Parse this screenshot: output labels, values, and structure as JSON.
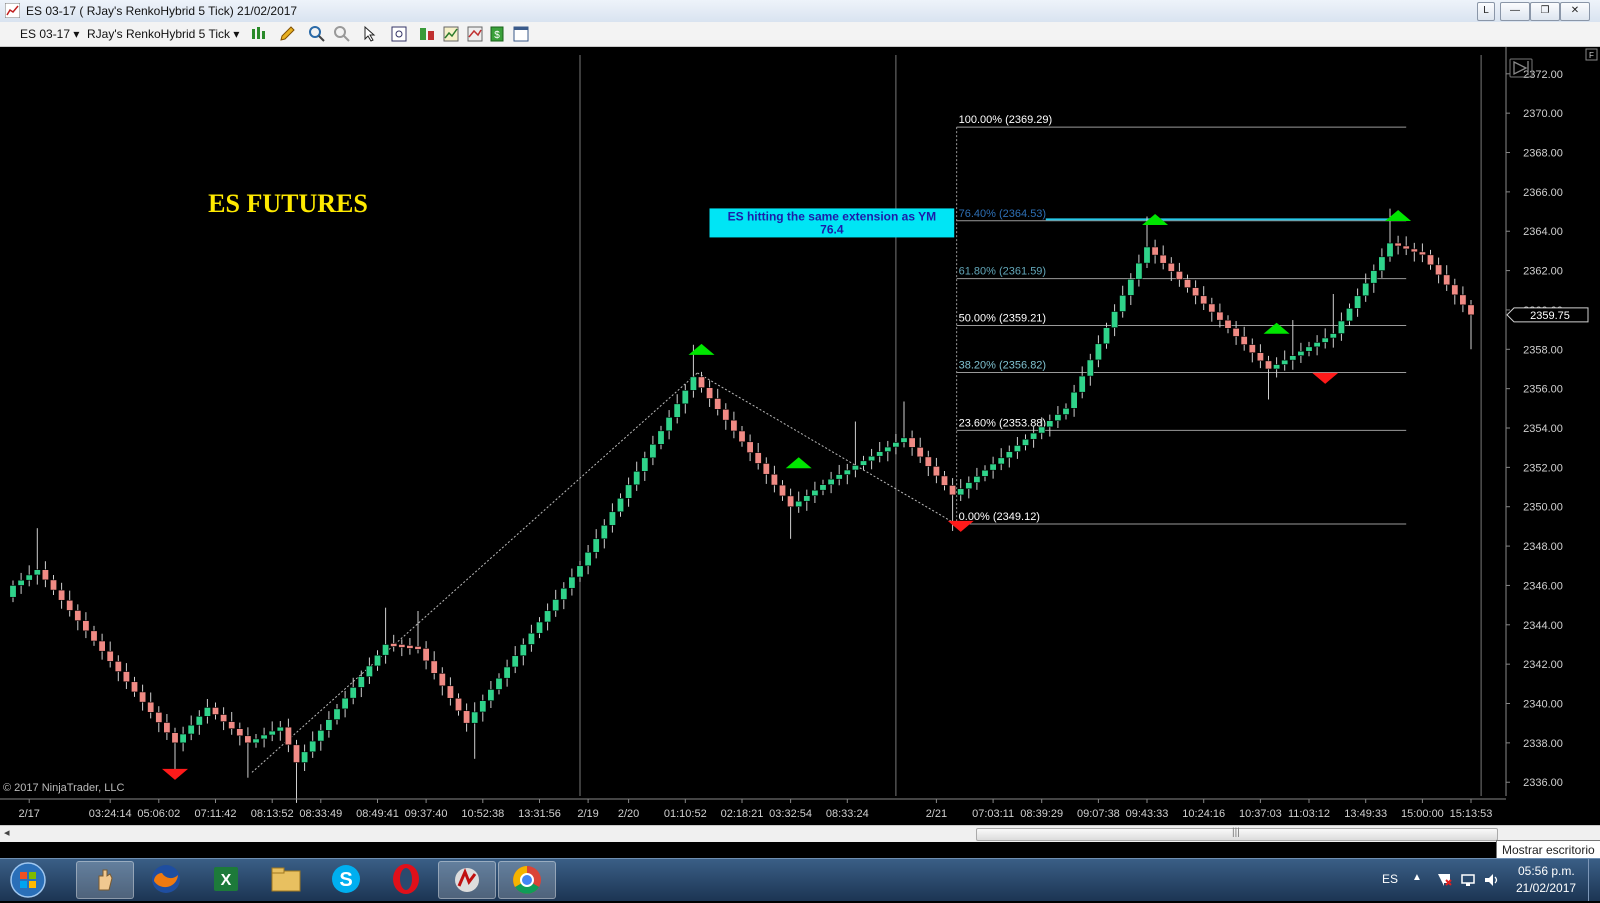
{
  "window": {
    "title": "ES 03-17 ( RJay's RenkoHybrid  5 Tick)  21/02/2017",
    "buttons": [
      "L",
      "—",
      "❐",
      "✕"
    ]
  },
  "toolbar": {
    "instrument": "ES 03-17",
    "period": "RJay's RenkoHybrid  5 Tick",
    "icons": [
      "bar-type-icon",
      "pencil-icon",
      "zoom-in-icon",
      "zoom-out-icon",
      "pointer-icon",
      "properties-icon",
      "data-box-icon",
      "indicators-icon",
      "strategies-icon",
      "template-icon",
      "window-icon"
    ]
  },
  "chart_data": {
    "type": "candlestick",
    "instrument": "ES 03-17",
    "bar_type": "RJay's RenkoHybrid 5 Tick",
    "y_ticks": [
      "2372.00",
      "2370.00",
      "2368.00",
      "2366.00",
      "2364.00",
      "2362.00",
      "2360.00",
      "2358.00",
      "2356.00",
      "2354.00",
      "2352.00",
      "2350.00",
      "2348.00",
      "2346.00",
      "2344.00",
      "2342.00",
      "2340.00",
      "2338.00",
      "2336.00"
    ],
    "ylim": [
      2335.3,
      2372.6
    ],
    "x_ticks": [
      {
        "label": "2/17",
        "i": 2
      },
      {
        "label": "03:24:14",
        "i": 12
      },
      {
        "label": "05:06:02",
        "i": 18
      },
      {
        "label": "07:11:42",
        "i": 25
      },
      {
        "label": "08:13:52",
        "i": 32
      },
      {
        "label": "08:33:49",
        "i": 38
      },
      {
        "label": "08:49:41",
        "i": 45
      },
      {
        "label": "09:37:40",
        "i": 51
      },
      {
        "label": "10:52:38",
        "i": 58
      },
      {
        "label": "13:31:56",
        "i": 65
      },
      {
        "label": "2/19",
        "i": 71
      },
      {
        "label": "2/20",
        "i": 76
      },
      {
        "label": "01:10:52",
        "i": 83
      },
      {
        "label": "02:18:21",
        "i": 90
      },
      {
        "label": "03:32:54",
        "i": 96
      },
      {
        "label": "08:33:24",
        "i": 103
      },
      {
        "label": "2/21",
        "i": 114
      },
      {
        "label": "07:03:11",
        "i": 121
      },
      {
        "label": "08:39:29",
        "i": 127
      },
      {
        "label": "09:07:38",
        "i": 134
      },
      {
        "label": "09:43:33",
        "i": 140
      },
      {
        "label": "10:24:16",
        "i": 147
      },
      {
        "label": "10:37:03",
        "i": 154
      },
      {
        "label": "11:03:12",
        "i": 160
      },
      {
        "label": "13:49:33",
        "i": 167
      },
      {
        "label": "15:00:00",
        "i": 174
      },
      {
        "label": "15:13:53",
        "i": 180
      }
    ],
    "session_breaks": [
      70,
      109
    ],
    "last_bar_marker": 181,
    "keypoints": [
      [
        0,
        2346
      ],
      [
        3,
        2346.8
      ],
      [
        20,
        2338
      ],
      [
        24,
        2339.8
      ],
      [
        29,
        2338
      ],
      [
        33,
        2338.8
      ],
      [
        35,
        2337
      ],
      [
        46,
        2343
      ],
      [
        50,
        2342.8
      ],
      [
        56,
        2339
      ],
      [
        70,
        2347
      ],
      [
        84,
        2356.6
      ],
      [
        96,
        2350
      ],
      [
        101,
        2351.4
      ],
      [
        110,
        2353.5
      ],
      [
        116,
        2350.6
      ],
      [
        130,
        2355
      ],
      [
        140,
        2363.2
      ],
      [
        155,
        2357
      ],
      [
        163,
        2358.8
      ],
      [
        168,
        2362
      ],
      [
        170,
        2363.4
      ],
      [
        174,
        2362.8
      ],
      [
        180,
        2359.75
      ]
    ],
    "wick_up": {
      "3": 1.8,
      "46": 1.5,
      "50": 1.6,
      "84": 1.2,
      "104": 1.8,
      "110": 1.6,
      "140": 1.3,
      "158": 1.5,
      "163": 1.7,
      "170": 1.5
    },
    "wick_down": {
      "20": 1.6,
      "29": 1.4,
      "35": 1.8,
      "57": 1.5,
      "96": 1.2,
      "116": 1.4,
      "155": 1.3,
      "180": 1.5
    },
    "signals": [
      {
        "i": 20,
        "dir": "down"
      },
      {
        "i": 85,
        "dir": "up"
      },
      {
        "i": 97,
        "dir": "up"
      },
      {
        "i": 117,
        "dir": "down"
      },
      {
        "i": 141,
        "dir": "up"
      },
      {
        "i": 156,
        "dir": "up"
      },
      {
        "i": 162,
        "dir": "down"
      },
      {
        "i": 171,
        "dir": "up"
      }
    ],
    "zigzag": [
      [
        29.5,
        2336.5
      ],
      [
        84.5,
        2356.8
      ],
      [
        116.5,
        2349.1
      ]
    ],
    "fibonacci": {
      "x_start": 116.5,
      "x_end": 172,
      "levels": [
        {
          "label": "100.00% (2369.29)",
          "price": 2369.29,
          "color": "#ffffff"
        },
        {
          "label": "76.40% (2364.53)",
          "price": 2364.53,
          "color": "#2d6fb5"
        },
        {
          "label": "61.80% (2361.59)",
          "price": 2361.59,
          "color": "#62a6b8"
        },
        {
          "label": "50.00% (2359.21)",
          "price": 2359.21,
          "color": "#ffffff"
        },
        {
          "label": "38.20% (2356.82)",
          "price": 2356.82,
          "color": "#7fc1cf"
        },
        {
          "label": "23.60% (2353.88)",
          "price": 2353.88,
          "color": "#ffffff"
        },
        {
          "label": "0.00% (2349.12)",
          "price": 2349.12,
          "color": "#ffffff"
        }
      ]
    },
    "extension_line": {
      "price": 2364.6,
      "x_start": 127.5,
      "x_end": 172,
      "color": "#27c8e8"
    },
    "annotation": {
      "lines": [
        "ES hitting the same extension as YM",
        "76.4"
      ],
      "box_color": "#00e5f5",
      "text_color": "#1c1ca8"
    },
    "chart_title": "ES FUTURES",
    "current_price": "2359.75",
    "copyright": "© 2017 NinjaTrader, LLC",
    "colors": {
      "up": "#2fd38a",
      "down": "#f08a84",
      "title": "#ffea00",
      "signal_up": "#00e600",
      "signal_down": "#ff1a1a"
    }
  },
  "taskbar": {
    "apps": [
      "windows-start-icon",
      "ninjatrader-icon",
      "firefox-icon",
      "excel-icon",
      "explorer-icon",
      "skype-icon",
      "opera-icon",
      "ninja-app-icon",
      "chrome-icon"
    ],
    "language": "ES",
    "time": "05:56 p.m.",
    "date": "21/02/2017",
    "tooltip": "Mostrar escritorio"
  }
}
